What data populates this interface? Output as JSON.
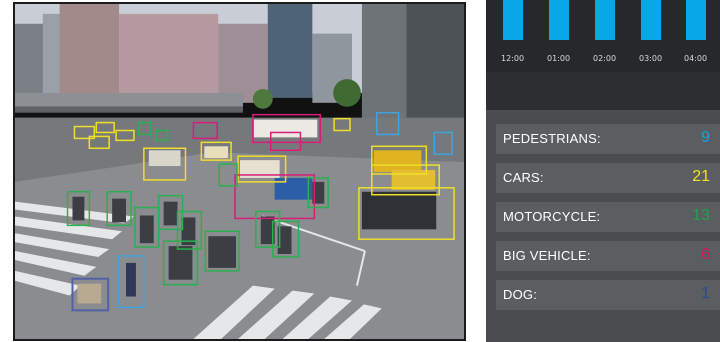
{
  "histogram": {
    "ticks": [
      "12:00",
      "01:00",
      "02:00",
      "03:00",
      "04:00"
    ],
    "bar_color": "#07a8e6"
  },
  "stats": [
    {
      "label": "PEDESTRIANS:",
      "value": "9",
      "color": "#1aa0e0"
    },
    {
      "label": "CARS:",
      "value": "21",
      "color": "#f2e21c"
    },
    {
      "label": "MOTORCYCLE:",
      "value": "13",
      "color": "#25a04a"
    },
    {
      "label": "BIG VEHICLE:",
      "value": "6",
      "color": "#d11763"
    },
    {
      "label": "DOG:",
      "value": "1",
      "color": "#2a4a9a"
    }
  ]
}
